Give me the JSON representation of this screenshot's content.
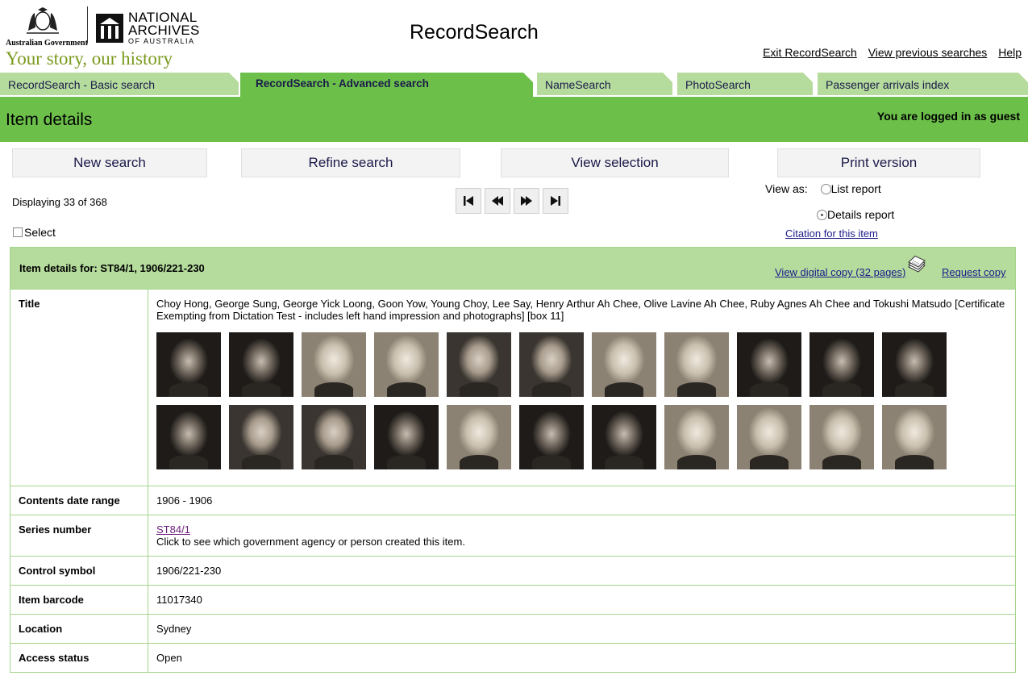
{
  "header": {
    "gov_label": "Australian Government",
    "naa_line1": "NATIONAL",
    "naa_line2": "ARCHIVES",
    "naa_line3": "OF AUSTRALIA",
    "tagline": "Your story, our history",
    "app_title": "RecordSearch",
    "links": [
      "Exit RecordSearch",
      "View previous searches",
      "Help"
    ]
  },
  "tabs": [
    {
      "label": "RecordSearch - Basic search"
    },
    {
      "label": "RecordSearch - Advanced search"
    },
    {
      "label": "NameSearch"
    },
    {
      "label": "PhotoSearch"
    },
    {
      "label": "Passenger arrivals index"
    }
  ],
  "page": {
    "title": "Item details",
    "login_status": "You are logged in as guest"
  },
  "actions": {
    "new_search": "New search",
    "refine_search": "Refine search",
    "view_selection": "View selection",
    "print_version": "Print version"
  },
  "results": {
    "displaying": "Displaying 33 of 368"
  },
  "view_as": {
    "label": "View as:",
    "options": [
      "List report",
      "Details report"
    ],
    "selected": "Details report"
  },
  "select_label": "Select",
  "citation_link": "Citation for this item",
  "item": {
    "header": "Item details for: ST84/1, 1906/221-230",
    "digital_copy_link": "View digital copy (32 pages)",
    "request_copy_link": "Request copy",
    "rows": [
      {
        "label": "Title",
        "value": "Choy Hong, George Sung, George Yick Loong, Goon Yow, Young Choy, Lee Say, Henry Arthur Ah Chee, Olive Lavine Ah Chee, Ruby Agnes Ah Chee and Tokushi Matsudo [Certificate Exempting from Dictation Test - includes left hand impression and photographs] [box 11]"
      },
      {
        "label": "Contents date range",
        "value": "1906 - 1906"
      },
      {
        "label": "Series number",
        "link": "ST84/1",
        "value": "Click to see which government agency or person created this item."
      },
      {
        "label": "Control symbol",
        "value": "1906/221-230"
      },
      {
        "label": "Item barcode",
        "value": "11017340"
      },
      {
        "label": "Location",
        "value": "Sydney"
      },
      {
        "label": "Access status",
        "value": "Open"
      }
    ],
    "photo_count": 22
  },
  "colors": {
    "green_primary": "#6cc04a",
    "green_light": "#b5dc9c",
    "button_bg": "#f3f3f3",
    "link": "#1a1a8c"
  }
}
